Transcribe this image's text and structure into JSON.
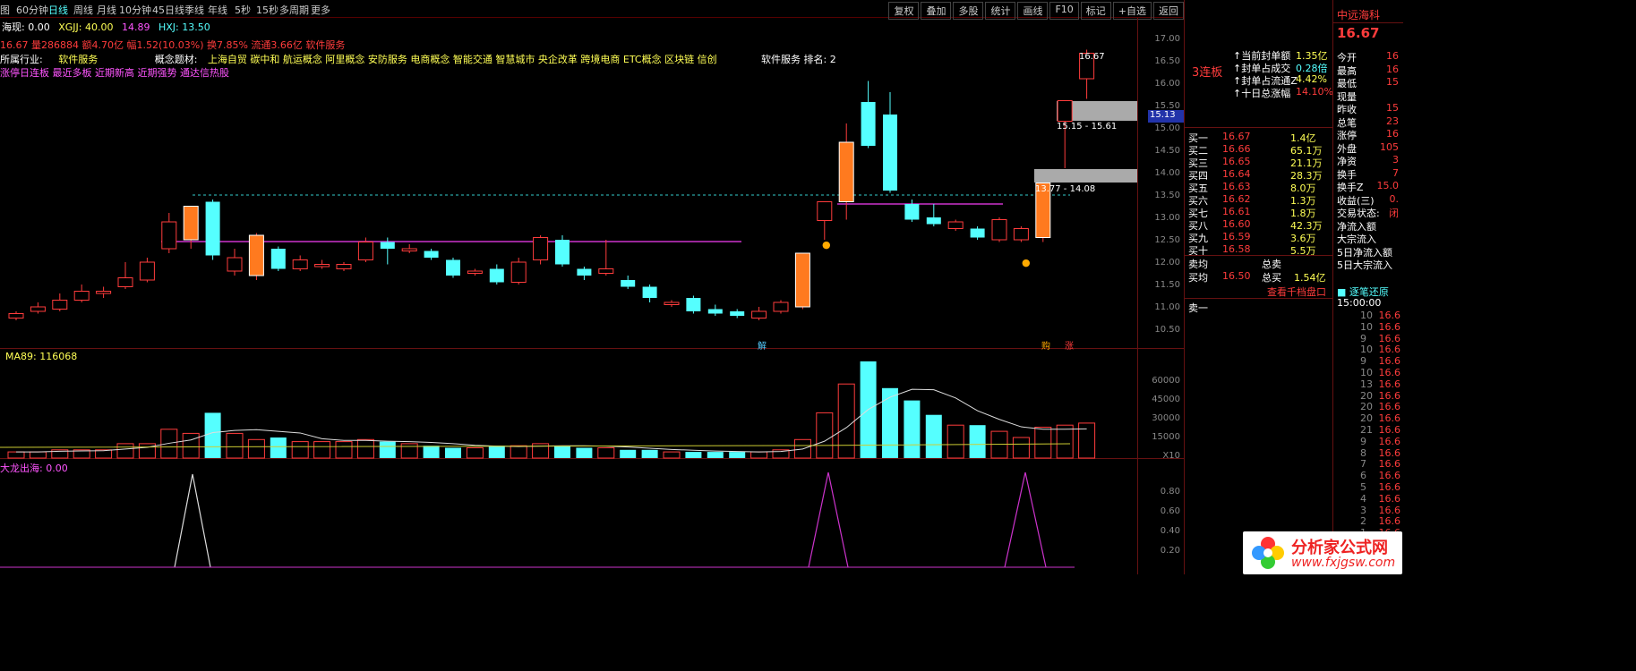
{
  "toolbar": {
    "periods": [
      "图",
      "60分钟",
      "日线",
      "周线",
      "月线",
      "10分钟",
      "45日线",
      "季线",
      "年线",
      "5秒",
      "15秒",
      "多周期",
      "更多"
    ],
    "buttons": [
      "复权",
      "叠加",
      "多股",
      "统计",
      "画线",
      "F10",
      "标记",
      "+自选",
      "返回"
    ]
  },
  "info_line1": {
    "label": "海现: 0.00",
    "xgjj": "XGJJ: 40.00",
    "v": "14.89",
    "hxj": "HXJ: 13.50"
  },
  "info_line2": {
    "text": "16.67 量286884 额4.70亿 幅1.52(10.03%) 换7.85% 流通3.66亿 软件服务"
  },
  "industry": {
    "label": "所属行业:",
    "value": "软件服务",
    "concept_label": "概念题材:",
    "concepts": "上海自贸 碳中和 航运概念 阿里概念 安防服务 电商概念 智能交通 智慧城市 央企改革 跨境电商 ETC概念 区块链 信创",
    "rank": "软件服务 排名: 2"
  },
  "tags": "涨停日连板 最近多板 近期新高 近期强势 通达信热股",
  "price_axis": [
    "17.00",
    "16.50",
    "16.00",
    "15.50",
    "15.00",
    "14.50",
    "14.00",
    "13.50",
    "13.00",
    "12.50",
    "12.00",
    "11.50",
    "11.00",
    "10.50"
  ],
  "vol_axis": [
    "60000",
    "45000",
    "30000",
    "15000",
    "X10"
  ],
  "ind_axis": [
    "0.80",
    "0.60",
    "0.40",
    "0.20"
  ],
  "price_labels": {
    "high": "16.67",
    "zone1": "15.15 - 15.61",
    "zone2": "13.77 - 14.08",
    "cursor": "15.13"
  },
  "ma_label": "MA89: 116068",
  "ind_label": "大龙出海: 0.00",
  "markers": {
    "jie": "解",
    "hui": "购",
    "zhang": "涨"
  },
  "seal": {
    "title": "3连板",
    "rows": [
      {
        "k": "当前封单额",
        "v": "1.35亿"
      },
      {
        "k": "封单占成交",
        "v": "0.28倍"
      },
      {
        "k": "封单占流通Z",
        "v": "4.42%"
      },
      {
        "k": "十日总涨幅",
        "v": "14.10%"
      }
    ]
  },
  "bids": [
    {
      "name": "买一",
      "price": "16.67",
      "vol": "1.4亿"
    },
    {
      "name": "买二",
      "price": "16.66",
      "vol": "65.1万"
    },
    {
      "name": "买三",
      "price": "16.65",
      "vol": "21.1万"
    },
    {
      "name": "买四",
      "price": "16.64",
      "vol": "28.3万"
    },
    {
      "name": "买五",
      "price": "16.63",
      "vol": "8.0万"
    },
    {
      "name": "买六",
      "price": "16.62",
      "vol": "1.3万"
    },
    {
      "name": "买七",
      "price": "16.61",
      "vol": "1.8万"
    },
    {
      "name": "买八",
      "price": "16.60",
      "vol": "42.3万"
    },
    {
      "name": "买九",
      "price": "16.59",
      "vol": "3.6万"
    },
    {
      "name": "买十",
      "price": "16.58",
      "vol": "5.5万"
    }
  ],
  "summary": {
    "ask_avg": "卖均",
    "total_sell": "总卖",
    "bid_avg": "买均",
    "bid_avg_v": "16.50",
    "total_buy": "总买",
    "total_buy_v": "1.54亿",
    "ask1": "卖一",
    "depth_link": "查看千档盘口"
  },
  "stock": {
    "name": "中远海科",
    "price": "16.67",
    "fields": [
      "今开",
      "最高",
      "最低",
      "现量",
      "昨收",
      "总笔",
      "涨停",
      "外盘",
      "净资",
      "换手",
      "换手Z",
      "收益(三)",
      "交易状态:",
      "净流入额",
      "大宗流入",
      "5日净流入额",
      "5日大宗流入"
    ],
    "values": [
      "16",
      "16",
      "15",
      "",
      "15",
      "23",
      "16",
      "105",
      "3",
      "7",
      "15.0",
      "0.",
      "闭"
    ]
  },
  "ticks": {
    "header": "逐笔还原",
    "time": "15:00:00",
    "prices": [
      "16.6",
      "16.6",
      "16.6",
      "16.6",
      "16.6",
      "16.6",
      "16.6",
      "16.6",
      "16.6",
      "16.6",
      "16.6",
      "16.6",
      "16.6",
      "16.6",
      "16.6",
      "16.6",
      "16.6",
      "16.6",
      "16.6",
      "16.6"
    ],
    "nums": [
      "10",
      "10",
      "9",
      "10",
      "9",
      "10",
      "13",
      "20",
      "20",
      "20",
      "21",
      "9",
      "8",
      "7",
      "6",
      "5",
      "4",
      "3",
      "2",
      "1"
    ]
  },
  "logo": {
    "name": "分析家公式网",
    "url": "www.fxjgsw.com"
  },
  "colors": {
    "up": "#ff7a1f",
    "down": "#55ffff",
    "ma": "#cc33cc",
    "accent": "#ff3c3c"
  }
}
